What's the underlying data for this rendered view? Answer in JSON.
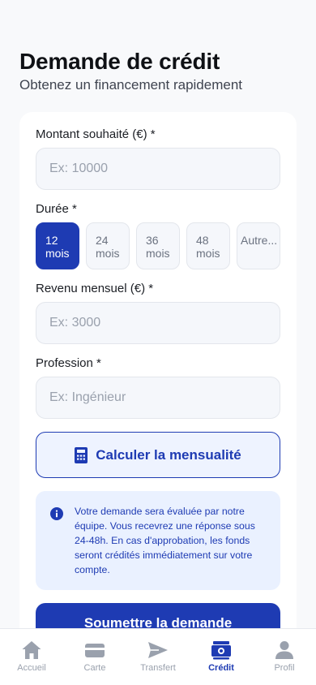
{
  "header": {
    "title": "Demande de crédit",
    "subtitle": "Obtenez un financement rapidement"
  },
  "form": {
    "amount": {
      "label": "Montant souhaité (€) *",
      "placeholder": "Ex: 10000",
      "value": ""
    },
    "duration": {
      "label": "Durée *",
      "options": [
        "12 mois",
        "24 mois",
        "36 mois",
        "48 mois",
        "Autre..."
      ],
      "selected": "12 mois"
    },
    "income": {
      "label": "Revenu mensuel (€) *",
      "placeholder": "Ex: 3000",
      "value": ""
    },
    "profession": {
      "label": "Profession *",
      "placeholder": "Ex: Ingénieur",
      "value": ""
    },
    "calculate_label": "Calculer la mensualité",
    "notice": "Votre demande sera évaluée par notre équipe. Vous recevrez une réponse sous 24-48h. En cas d'approbation, les fonds seront crédités immédiatement sur votre compte.",
    "submit_label": "Soumettre la demande"
  },
  "tabbar": {
    "items": [
      {
        "label": "Accueil",
        "icon": "home-icon"
      },
      {
        "label": "Carte",
        "icon": "card-icon"
      },
      {
        "label": "Transfert",
        "icon": "send-icon"
      },
      {
        "label": "Crédit",
        "icon": "money-icon"
      },
      {
        "label": "Profil",
        "icon": "user-icon"
      }
    ],
    "active": "Crédit"
  },
  "colors": {
    "primary": "#1e3bb3",
    "background": "#f8f9fb",
    "input_bg": "#f5f7fb",
    "notice_bg": "#eaf1ff",
    "muted": "#9aa1ad"
  }
}
